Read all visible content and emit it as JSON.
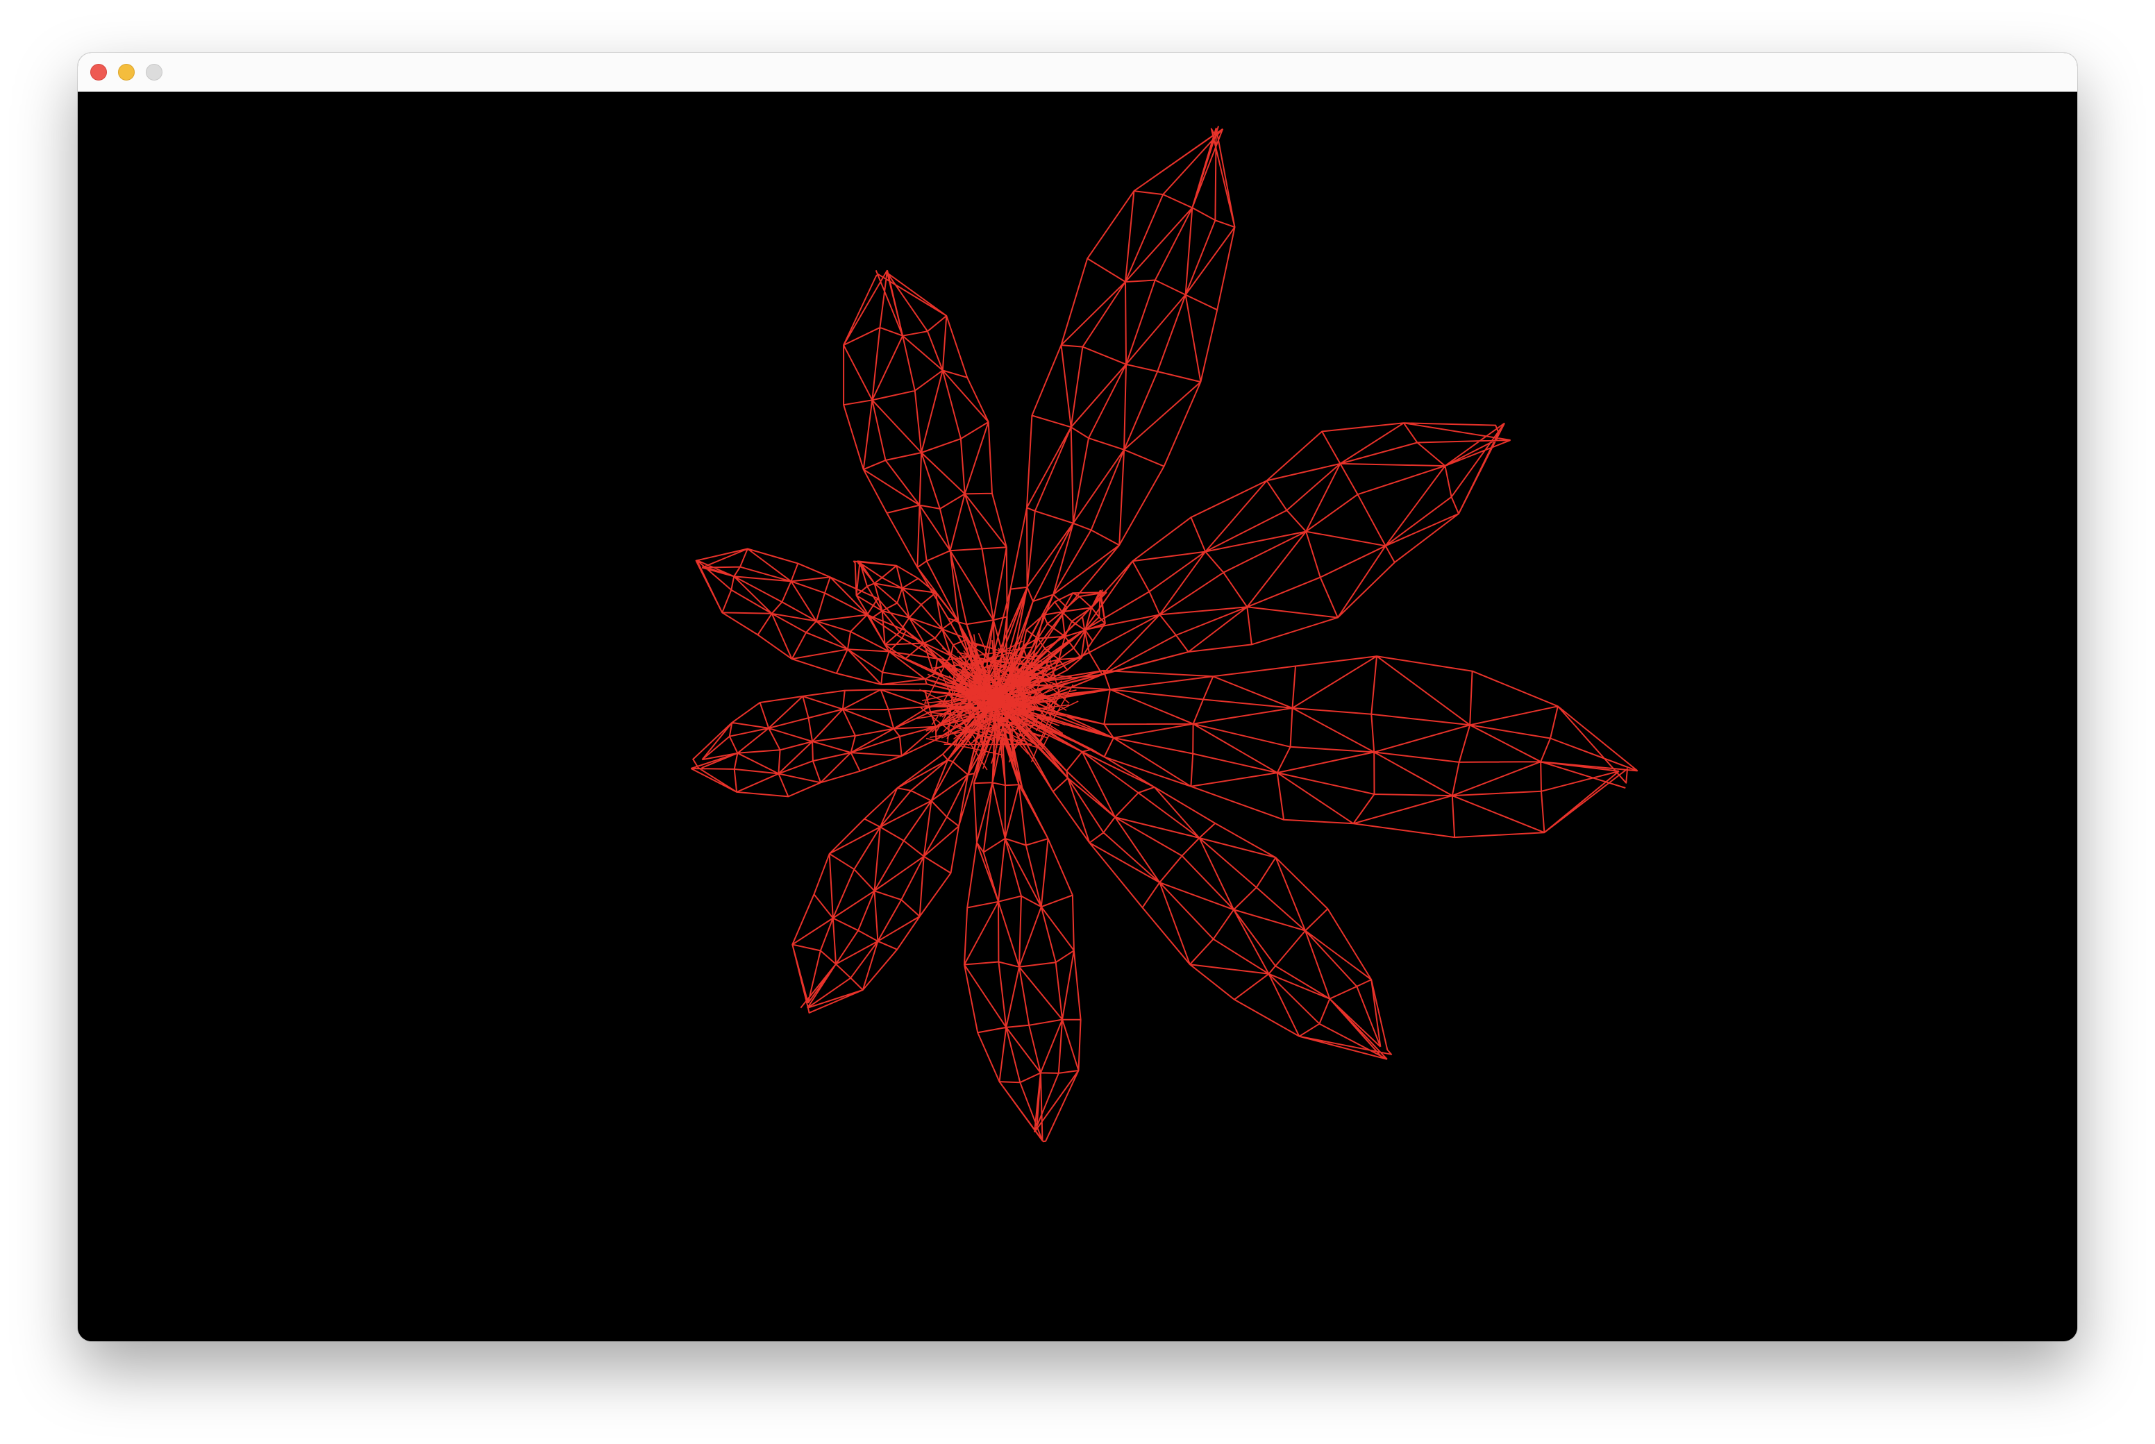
{
  "window": {
    "title": "",
    "controls": [
      "close",
      "minimize",
      "maximize"
    ]
  },
  "scene": {
    "background_color": "#000000",
    "wire_color": "#e8322a",
    "render_mode": "wireframe",
    "subject": "flower"
  },
  "colors": {
    "close": "#ee5a52",
    "minimize": "#f4bd3d",
    "maximize": "#dcdcdc",
    "titlebar": "#fbfbfb"
  }
}
